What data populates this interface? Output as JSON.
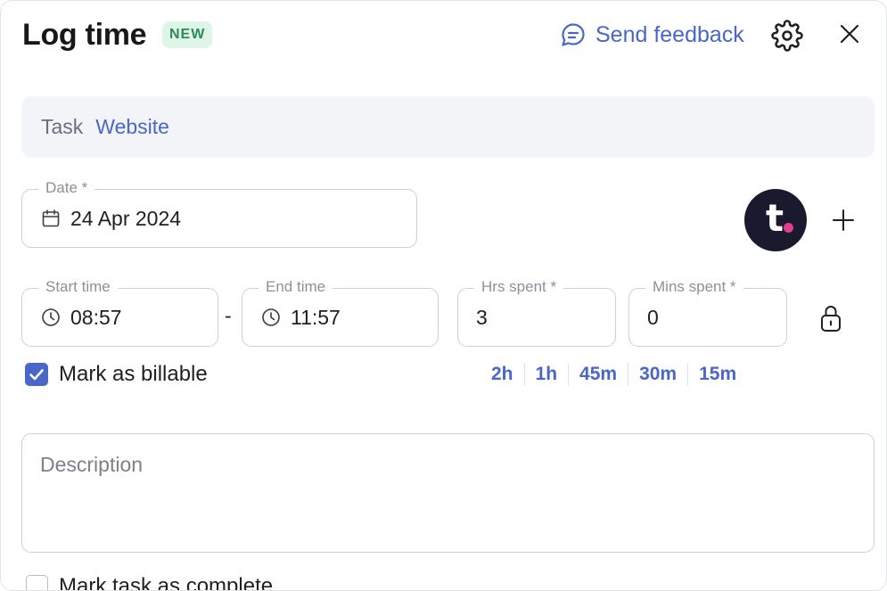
{
  "header": {
    "title": "Log time",
    "badge": "NEW",
    "feedback_label": "Send feedback",
    "feedback_icon": "chat-bubble-icon",
    "settings_icon": "gear-icon",
    "close_icon": "close-icon"
  },
  "task": {
    "label": "Task",
    "value": "Website"
  },
  "date": {
    "label": "Date *",
    "value": "24 Apr 2024",
    "icon": "calendar-icon"
  },
  "assignee": {
    "avatar_letter": "t",
    "avatar_bg": "#1a1a2e",
    "avatar_dot_color": "#e23d8f",
    "add_icon": "plus-icon"
  },
  "time": {
    "start_label": "Start time",
    "start_value": "08:57",
    "separator": "-",
    "end_label": "End time",
    "end_value": "11:57",
    "hrs_label": "Hrs spent *",
    "hrs_value": "3",
    "mins_label": "Mins spent *",
    "mins_value": "0",
    "clock_icon": "clock-icon",
    "lock_icon": "lock-icon"
  },
  "billable": {
    "label": "Mark as billable",
    "checked": true
  },
  "quick_durations": [
    "2h",
    "1h",
    "45m",
    "30m",
    "15m"
  ],
  "description": {
    "placeholder": "Description"
  },
  "complete": {
    "label": "Mark task as complete",
    "checked": false
  },
  "colors": {
    "accent": "#4a66c9",
    "badge_bg": "#dff5e8",
    "badge_text": "#2e8a5a",
    "task_strip_bg": "#f2f4f8"
  }
}
